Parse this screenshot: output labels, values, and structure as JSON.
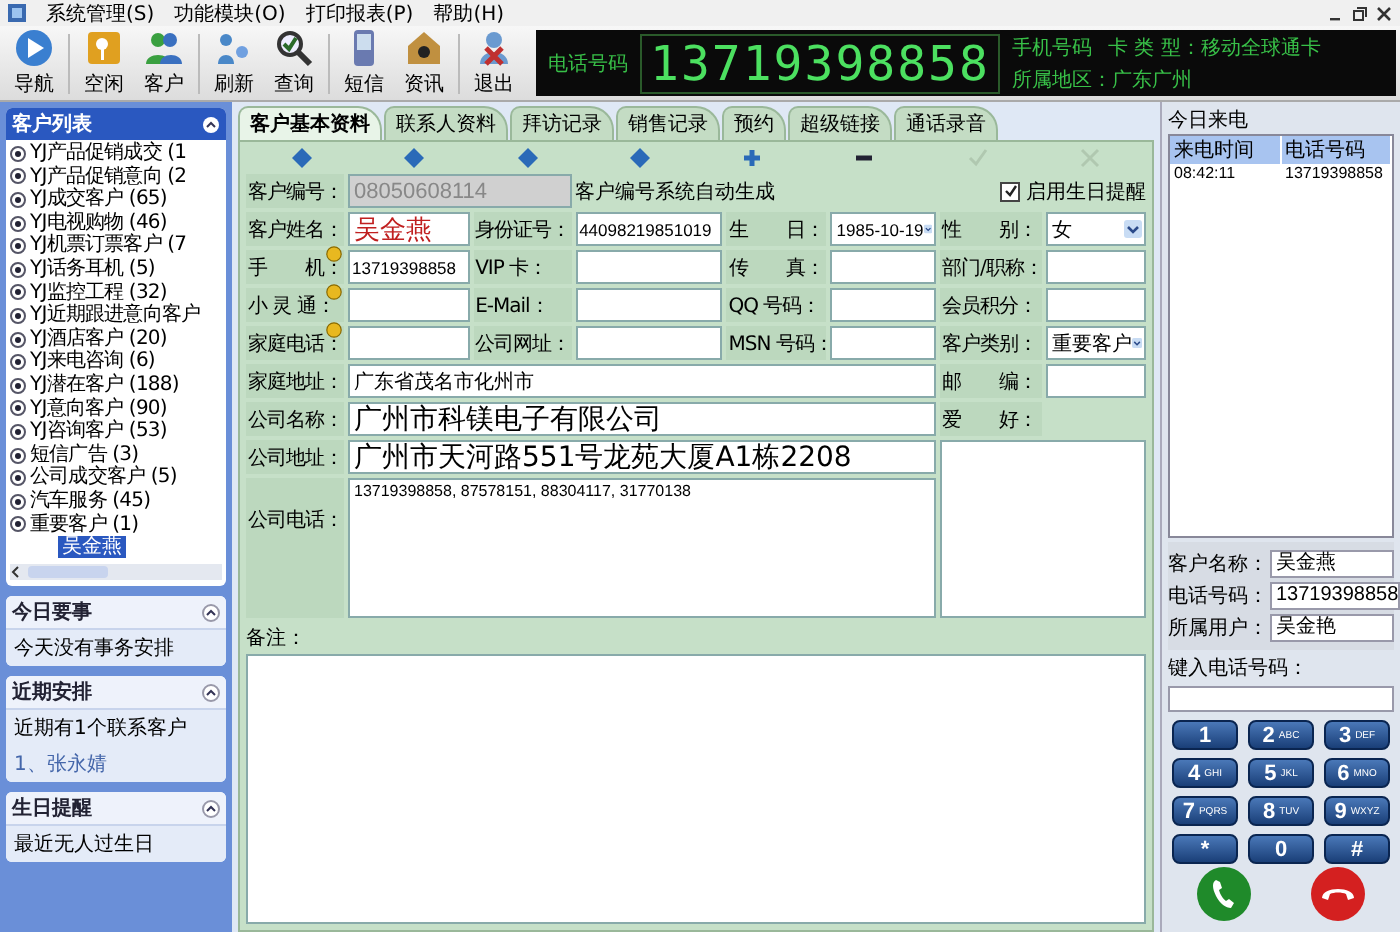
{
  "menu": [
    "系统管理(S)",
    "功能模块(O)",
    "打印报表(P)",
    "帮助(H)"
  ],
  "toolbar": [
    "导航",
    "空闲",
    "客户",
    "刷新",
    "查询",
    "短信",
    "资讯",
    "退出"
  ],
  "caller_display": {
    "label": "电话号码",
    "number": "13719398858",
    "phone_type": "手机号码",
    "card_type": "卡 类 型：移动全球通卡",
    "region": "所属地区：广东广州"
  },
  "sidebar": {
    "customer_list": {
      "title": "客户列表",
      "items": [
        {
          "label": "YJ产品促销成交 (1",
          "selected": false
        },
        {
          "label": "YJ产品促销意向 (2",
          "selected": false
        },
        {
          "label": "YJ成交客户 (65)",
          "selected": false
        },
        {
          "label": "YJ电视购物 (46)",
          "selected": false
        },
        {
          "label": "YJ机票订票客户 (7",
          "selected": false
        },
        {
          "label": "YJ话务耳机 (5)",
          "selected": false
        },
        {
          "label": "YJ监控工程 (32)",
          "selected": false
        },
        {
          "label": "YJ近期跟进意向客户",
          "selected": false
        },
        {
          "label": "YJ酒店客户 (20)",
          "selected": false
        },
        {
          "label": "YJ来电咨询 (6)",
          "selected": false
        },
        {
          "label": "YJ潜在客户 (188)",
          "selected": false
        },
        {
          "label": "YJ意向客户 (90)",
          "selected": false
        },
        {
          "label": "YJ咨询客户 (53)",
          "selected": false
        },
        {
          "label": "短信广告 (3)",
          "selected": false
        },
        {
          "label": "公司成交客户 (5)",
          "selected": false
        },
        {
          "label": "汽车服务 (45)",
          "selected": false
        },
        {
          "label": "重要客户 (1)",
          "selected": false,
          "children": [
            {
              "label": "吴金燕",
              "selected": true
            }
          ]
        }
      ]
    },
    "panels": [
      {
        "title": "今日要事",
        "lines": [
          {
            "kind": "text",
            "text": "今天没有事务安排"
          }
        ]
      },
      {
        "title": "近期安排",
        "lines": [
          {
            "kind": "text",
            "text": "近期有1个联系客户"
          },
          {
            "kind": "link",
            "text": "1、张永婧"
          }
        ]
      },
      {
        "title": "生日提醒",
        "lines": [
          {
            "kind": "text",
            "text": "最近无人过生日"
          }
        ]
      }
    ]
  },
  "tabs": [
    {
      "label": "客户基本资料",
      "selected": true
    },
    {
      "label": "联系人资料",
      "selected": false
    },
    {
      "label": "拜访记录",
      "selected": false
    },
    {
      "label": "销售记录",
      "selected": false
    },
    {
      "label": "预约",
      "selected": false
    },
    {
      "label": "超级链接",
      "selected": false
    },
    {
      "label": "通话录音",
      "selected": false
    }
  ],
  "record_toolbar": [
    {
      "kind": "first",
      "disabled": false
    },
    {
      "kind": "prev",
      "disabled": false
    },
    {
      "kind": "next",
      "disabled": false
    },
    {
      "kind": "last",
      "disabled": false
    },
    {
      "kind": "add",
      "disabled": false
    },
    {
      "kind": "delete",
      "disabled": false
    },
    {
      "kind": "save",
      "disabled": true
    },
    {
      "kind": "cancel",
      "disabled": true
    }
  ],
  "form": {
    "customer_id": {
      "label": "客户编号：",
      "value": "08050608114",
      "disabled": true,
      "note": "客户编号系统自动生成"
    },
    "birthday_reminder": {
      "label": "启用生日提醒",
      "checked": true
    },
    "rows": [
      [
        {
          "label": "客户姓名：",
          "value": "吴金燕",
          "kind": "name",
          "hint": false
        },
        {
          "label": "身份证号：",
          "value": "44098219851019",
          "kind": "input",
          "hint": false
        },
        {
          "label": "生　　日：",
          "value": "1985-10-19",
          "kind": "date",
          "hint": false
        },
        {
          "label": "性　　别：",
          "value": "女",
          "kind": "select",
          "hint": false
        }
      ],
      [
        {
          "label": "手　　机：",
          "value": "13719398858",
          "kind": "input",
          "hint": true
        },
        {
          "label": "VIP 卡：",
          "kind": "input",
          "hint": false
        },
        {
          "label": "传　　真：",
          "kind": "input",
          "hint": false
        },
        {
          "label": "部门/职称：",
          "kind": "input",
          "hint": false
        }
      ],
      [
        {
          "label": "小 灵 通：",
          "kind": "input",
          "hint": true
        },
        {
          "label": "E-Mail：",
          "kind": "input",
          "hint": false
        },
        {
          "label": "QQ 号码：",
          "kind": "input",
          "hint": false
        },
        {
          "label": "会员积分：",
          "kind": "input",
          "hint": false
        }
      ],
      [
        {
          "label": "家庭电话：",
          "kind": "input",
          "hint": true
        },
        {
          "label": "公司网址：",
          "kind": "input",
          "hint": false
        },
        {
          "label": "MSN 号码：",
          "kind": "input",
          "hint": false
        },
        {
          "label": "客户类别：",
          "value": "重要客户",
          "kind": "select",
          "hint": false
        }
      ]
    ],
    "home_address": {
      "label": "家庭地址：",
      "value": "广东省茂名市化州市"
    },
    "postcode": {
      "label": "邮　　编："
    },
    "company_name": {
      "label": "公司名称：",
      "value": "广州市科镁电子有限公司"
    },
    "hobby": {
      "label": "爱　　好："
    },
    "company_address": {
      "label": "公司地址：",
      "value": "广州市天河路551号龙苑大厦A1栋2208"
    },
    "company_phone": {
      "label": "公司电话：",
      "value": "13719398858, 87578151, 88304117, 31770138"
    },
    "remarks": {
      "label": "备注："
    }
  },
  "incoming_calls": {
    "title": "今日来电",
    "columns": [
      "来电时间",
      "电话号码"
    ],
    "rows": [
      [
        "08:42:11",
        "13719398858"
      ]
    ]
  },
  "caller_info": [
    {
      "label": "客户名称：",
      "value": "吴金燕"
    },
    {
      "label": "电话号码：",
      "value": "13719398858"
    },
    {
      "label": "所属用户：",
      "value": "吴金艳"
    }
  ],
  "dial": {
    "label": "键入电话号码：",
    "keys": [
      {
        "digit": "1"
      },
      {
        "digit": "2",
        "letters": "ABC"
      },
      {
        "digit": "3",
        "letters": "DEF"
      },
      {
        "digit": "4",
        "letters": "GHI"
      },
      {
        "digit": "5",
        "letters": "JKL"
      },
      {
        "digit": "6",
        "letters": "MNO"
      },
      {
        "digit": "7",
        "letters": "PQRS"
      },
      {
        "digit": "8",
        "letters": "TUV"
      },
      {
        "digit": "9",
        "letters": "WXYZ"
      },
      {
        "digit": "*"
      },
      {
        "digit": "0"
      },
      {
        "digit": "#"
      }
    ]
  }
}
